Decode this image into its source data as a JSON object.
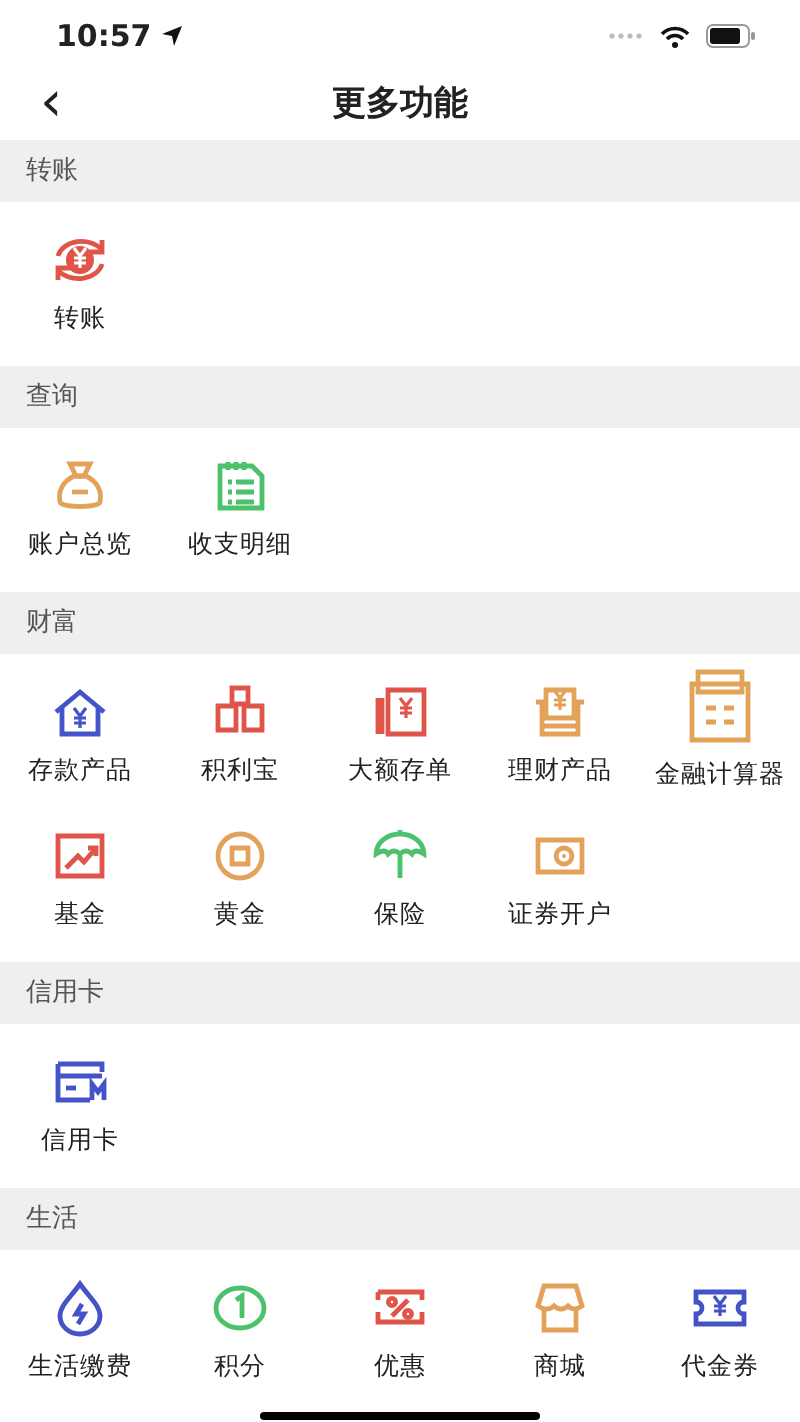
{
  "status_bar": {
    "time": "10:57"
  },
  "nav": {
    "back": "‹",
    "title": "更多功能"
  },
  "sections": [
    {
      "title": "转账",
      "items": [
        {
          "label": "转账"
        }
      ]
    },
    {
      "title": "查询",
      "items": [
        {
          "label": "账户总览"
        },
        {
          "label": "收支明细"
        }
      ]
    },
    {
      "title": "财富",
      "items": [
        {
          "label": "存款产品"
        },
        {
          "label": "积利宝"
        },
        {
          "label": "大额存单"
        },
        {
          "label": "理财产品"
        },
        {
          "label": "金融计算器"
        },
        {
          "label": "基金"
        },
        {
          "label": "黄金"
        },
        {
          "label": "保险"
        },
        {
          "label": "证券开户"
        }
      ]
    },
    {
      "title": "信用卡",
      "items": [
        {
          "label": "信用卡"
        }
      ]
    },
    {
      "title": "生活",
      "items": [
        {
          "label": "生活缴费"
        },
        {
          "label": "积分"
        },
        {
          "label": "优惠"
        },
        {
          "label": "商城"
        },
        {
          "label": "代金券"
        }
      ]
    }
  ]
}
